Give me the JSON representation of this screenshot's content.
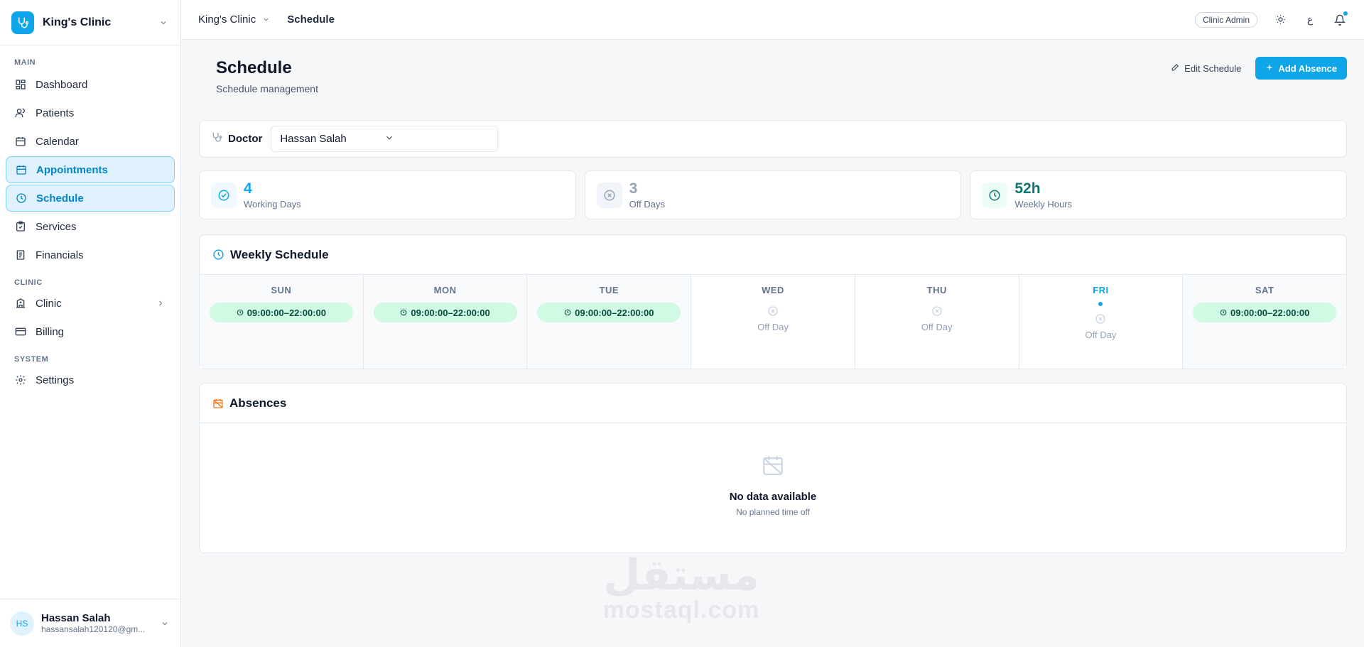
{
  "app": {
    "clinic_name": "King's Clinic"
  },
  "sidebar": {
    "sections": {
      "main": "MAIN",
      "clinic": "CLINIC",
      "system": "SYSTEM"
    },
    "items": [
      {
        "label": "Dashboard"
      },
      {
        "label": "Patients"
      },
      {
        "label": "Calendar"
      },
      {
        "label": "Appointments"
      },
      {
        "label": "Schedule"
      },
      {
        "label": "Services"
      },
      {
        "label": "Financials"
      },
      {
        "label": "Clinic"
      },
      {
        "label": "Billing"
      },
      {
        "label": "Settings"
      }
    ],
    "user": {
      "initials": "HS",
      "name": "Hassan Salah",
      "email": "hassansalah120120@gm..."
    }
  },
  "topbar": {
    "breadcrumb_clinic": "King's Clinic",
    "breadcrumb_current": "Schedule",
    "role": "Clinic Admin",
    "lang_label": "ع"
  },
  "page": {
    "title": "Schedule",
    "subtitle": "Schedule management",
    "edit_label": "Edit Schedule",
    "add_label": "Add Absence"
  },
  "doctor": {
    "label": "Doctor",
    "selected": "Hassan Salah"
  },
  "stats": [
    {
      "value": "4",
      "label": "Working Days",
      "color": "#0ea5e9"
    },
    {
      "value": "3",
      "label": "Off Days",
      "color": "#94a3b8"
    },
    {
      "value": "52h",
      "label": "Weekly Hours",
      "color": "#0f766e"
    }
  ],
  "weekly": {
    "title": "Weekly Schedule",
    "off_label": "Off Day",
    "days": [
      {
        "name": "SUN",
        "hours": "09:00:00–22:00:00"
      },
      {
        "name": "MON",
        "hours": "09:00:00–22:00:00"
      },
      {
        "name": "TUE",
        "hours": "09:00:00–22:00:00"
      },
      {
        "name": "WED",
        "hours": ""
      },
      {
        "name": "THU",
        "hours": ""
      },
      {
        "name": "FRI",
        "hours": "",
        "today": true
      },
      {
        "name": "SAT",
        "hours": "09:00:00–22:00:00"
      }
    ]
  },
  "absences": {
    "title": "Absences",
    "empty_title": "No data available",
    "empty_subtitle": "No planned time off"
  },
  "watermark": {
    "arabic": "مستقل",
    "latin": "mostaql.com"
  },
  "colors": {
    "accent": "#0ea5e9",
    "working_pill": "#d1fae5",
    "absence_icon": "#f97316"
  }
}
